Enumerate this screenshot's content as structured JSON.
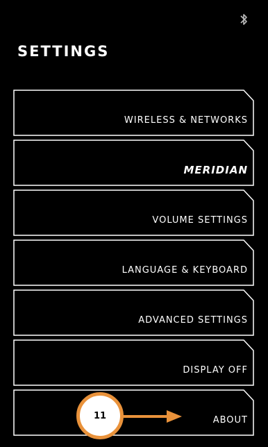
{
  "status_bar": {
    "bluetooth_icon": "bluetooth-icon"
  },
  "settings": {
    "title": "SETTINGS",
    "items": [
      {
        "label": "WIRELESS & NETWORKS"
      },
      {
        "label": "MERIDIAN"
      },
      {
        "label": "VOLUME SETTINGS"
      },
      {
        "label": "LANGUAGE & KEYBOARD"
      },
      {
        "label": "ADVANCED SETTINGS"
      },
      {
        "label": "DISPLAY OFF"
      },
      {
        "label": "ABOUT"
      }
    ]
  },
  "annotation": {
    "callout_number": "11",
    "arrow_color": "#e9923b"
  },
  "colors": {
    "background": "#000000",
    "foreground": "#ffffff",
    "accent": "#e9923b"
  }
}
